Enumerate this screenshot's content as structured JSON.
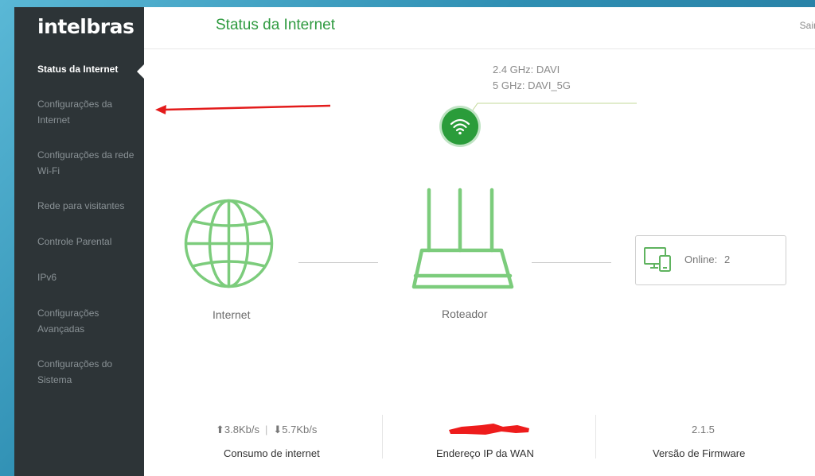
{
  "brand": {
    "logo": "intelbras"
  },
  "sidebar": {
    "items": [
      {
        "label": "Status da Internet",
        "active": true
      },
      {
        "label": "Configurações da Internet",
        "active": false
      },
      {
        "label": "Configurações da rede Wi-Fi",
        "active": false
      },
      {
        "label": "Rede para visitantes",
        "active": false
      },
      {
        "label": "Controle Parental",
        "active": false
      },
      {
        "label": "IPv6",
        "active": false
      },
      {
        "label": "Configurações Avançadas",
        "active": false
      },
      {
        "label": "Configurações do Sistema",
        "active": false
      }
    ]
  },
  "header": {
    "title": "Status da Internet",
    "logout": "Sair"
  },
  "wifi": {
    "ssid_24": "2.4 GHz: DAVI",
    "ssid_5": "5 GHz: DAVI_5G"
  },
  "topology": {
    "internet_label": "Internet",
    "router_label": "Roteador",
    "online_label": "Online:",
    "online_count": "2"
  },
  "stats": {
    "upload": "3.8Kb/s",
    "download": "5.7Kb/s",
    "separator": "|",
    "consumption_label": "Consumo de internet",
    "wan_ip_label": "Endereço IP da WAN",
    "firmware_value": "2.1.5",
    "firmware_label": "Versão de Firmware"
  },
  "colors": {
    "accent_green": "#2e9a3f",
    "icon_green": "#7ccc7c",
    "sidebar_bg": "#2d3437",
    "annotation_red": "#e31b1b"
  },
  "icons": {
    "wifi": "wifi-icon",
    "globe": "globe-icon",
    "router": "router-icon",
    "devices": "devices-icon",
    "up_arrow": "upload-arrow-icon",
    "down_arrow": "download-arrow-icon"
  }
}
